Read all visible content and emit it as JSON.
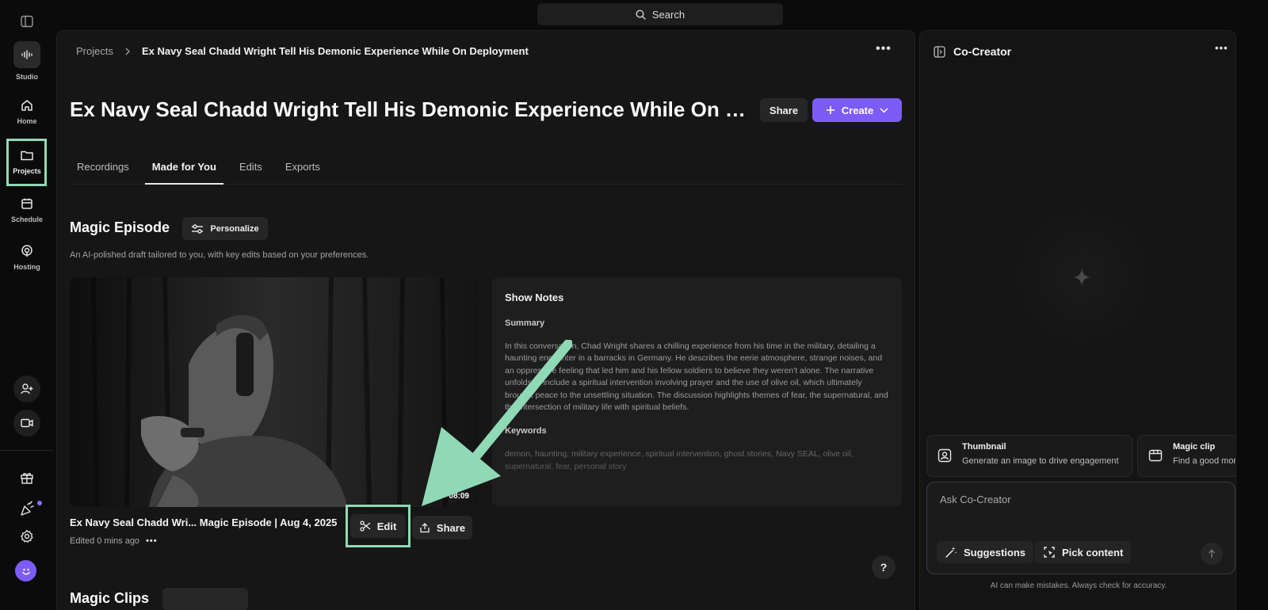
{
  "search": {
    "label": "Search"
  },
  "rail": {
    "studio": "Studio",
    "home": "Home",
    "projects": "Projects",
    "schedule": "Schedule",
    "hosting": "Hosting"
  },
  "breadcrumb": {
    "root": "Projects",
    "current": "Ex Navy Seal Chadd Wright Tell His Demonic Experience While On Deployment"
  },
  "header": {
    "title": "Ex Navy Seal Chadd Wright Tell His Demonic Experience While On Deployment",
    "share_label": "Share",
    "create_label": "Create"
  },
  "tabs": [
    {
      "label": "Recordings",
      "active": false
    },
    {
      "label": "Made for You",
      "active": true
    },
    {
      "label": "Edits",
      "active": false
    },
    {
      "label": "Exports",
      "active": false
    }
  ],
  "magic_episode": {
    "title": "Magic Episode",
    "personalize_label": "Personalize",
    "description": "An AI-polished draft tailored to you, with key edits based on your preferences.",
    "duration": "08:09",
    "video_title": "Ex Navy Seal Chadd Wri... Magic Episode | Aug 4, 2025",
    "edited_text": "Edited 0 mins ago",
    "edit_label": "Edit",
    "share_label": "Share"
  },
  "show_notes": {
    "title": "Show Notes",
    "summary_heading": "Summary",
    "summary": "In this conversation, Chad Wright shares a chilling experience from his time in the military, detailing a haunting encounter in a barracks in Germany. He describes the eerie atmosphere, strange noises, and an oppressive feeling that led him and his fellow soldiers to believe they weren't alone. The narrative unfolds to include a spiritual intervention involving prayer and the use of olive oil, which ultimately brought peace to the unsettling situation. The discussion highlights themes of fear, the supernatural, and the intersection of military life with spiritual beliefs.",
    "keywords_heading": "Keywords",
    "keywords": "demon, haunting, military experience, spiritual intervention, ghost stories, Navy SEAL, olive oil, supernatural, fear, personal story"
  },
  "next_section": {
    "title": "Magic Clips"
  },
  "help_label": "?",
  "co_creator": {
    "title": "Co-Creator",
    "cards": [
      {
        "title": "Thumbnail",
        "desc": "Generate an image to drive engagement"
      },
      {
        "title": "Magic clip",
        "desc": "Find a good moment"
      }
    ],
    "ask_placeholder": "Ask Co-Creator",
    "suggestions_label": "Suggestions",
    "pick_content_label": "Pick content",
    "disclaimer": "AI can make mistakes. Always check for accuracy."
  },
  "colors": {
    "accent": "#7c5cf6",
    "highlight": "#8fd9b6",
    "arrow": "#8fd9b6"
  }
}
